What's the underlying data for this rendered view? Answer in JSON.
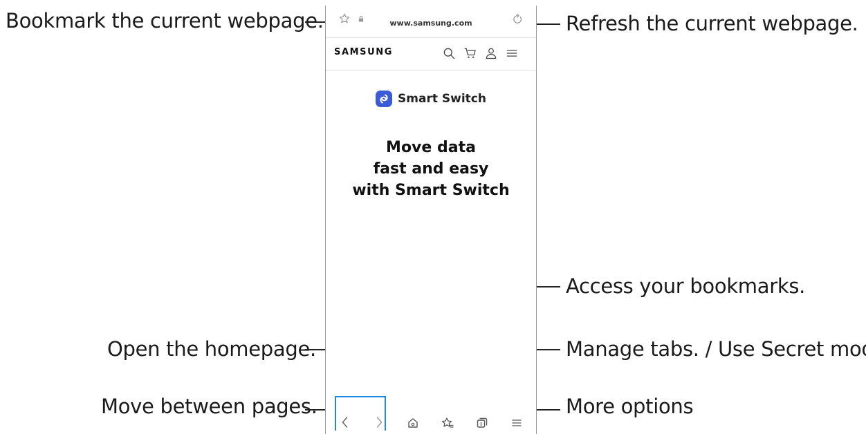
{
  "browser": {
    "url": "www.samsung.com",
    "site_logo": "SAMSUNG",
    "brand_name": "Smart Switch",
    "headline": [
      "Move data",
      "fast and easy",
      "with Smart Switch"
    ]
  },
  "callouts": {
    "bookmark_current": "Bookmark the current webpage.",
    "refresh_current": "Refresh the current webpage.",
    "access_bookmarks": "Access your bookmarks.",
    "open_homepage": "Open the homepage.",
    "manage_tabs": "Manage tabs. / Use Secret mode.",
    "move_between_pages": "Move between pages.",
    "more_options": "More options"
  },
  "icons": {
    "top": [
      "star-icon",
      "lock-icon",
      "refresh-icon"
    ],
    "nav": [
      "search-icon",
      "cart-icon",
      "account-icon",
      "menu-icon"
    ],
    "toolbar": [
      "back-icon",
      "forward-icon",
      "home-icon",
      "bookmarks-icon",
      "tabs-icon",
      "menu-icon"
    ]
  },
  "colors": {
    "highlight": "#1e88e5",
    "brand_icon": "#3a5ad6"
  }
}
